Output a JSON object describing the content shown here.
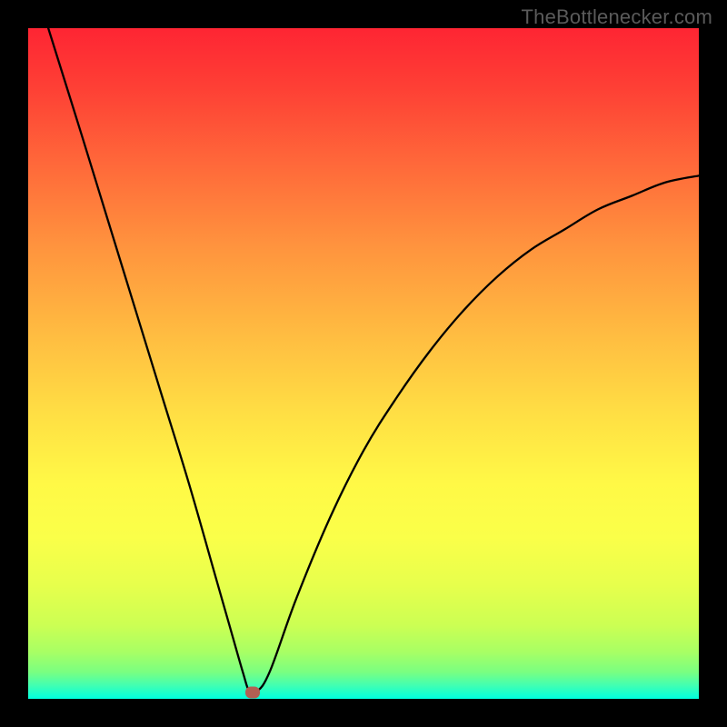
{
  "attribution": "TheBottlenecker.com",
  "colors": {
    "frame": "#000000",
    "curve": "#000000",
    "marker": "#b35f53",
    "gradient_top": "#fe2533",
    "gradient_bottom": "#00ffe0"
  },
  "chart_data": {
    "type": "line",
    "title": "",
    "xlabel": "",
    "ylabel": "",
    "xlim": [
      0,
      100
    ],
    "ylim": [
      0,
      100
    ],
    "grid": false,
    "legend": false,
    "series": [
      {
        "name": "bottleneck-curve",
        "x": [
          3,
          8,
          12,
          16,
          20,
          24,
          28,
          30,
          32,
          33,
          34,
          36,
          40,
          45,
          50,
          55,
          60,
          65,
          70,
          75,
          80,
          85,
          90,
          95,
          100
        ],
        "values": [
          100,
          84,
          71,
          58,
          45,
          32,
          18,
          11,
          4,
          1,
          1,
          4,
          15,
          27,
          37,
          45,
          52,
          58,
          63,
          67,
          70,
          73,
          75,
          77,
          78
        ]
      }
    ],
    "annotations": [
      {
        "name": "min-marker",
        "x": 33.5,
        "y": 1
      }
    ]
  }
}
